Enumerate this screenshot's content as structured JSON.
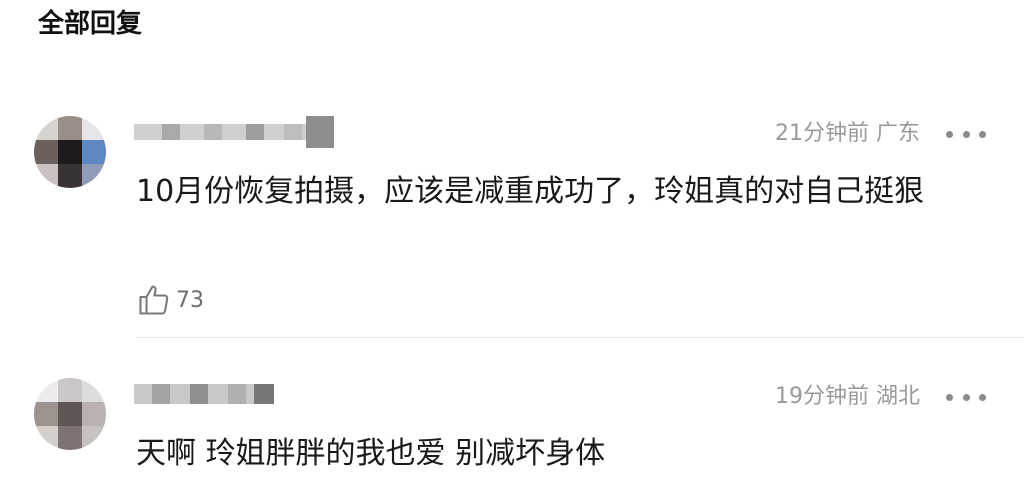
{
  "header": {
    "title": "全部回复"
  },
  "comments": [
    {
      "meta": "21分钟前 广东",
      "text": "10月份恢复拍摄，应该是减重成功了，玲姐真的对自己挺狠",
      "likes": "73",
      "like_icon": "thumbs-up-icon",
      "more_icon": "more-icon"
    },
    {
      "meta": "19分钟前 湖北",
      "text": "天啊 玲姐胖胖的我也爱 别减坏身体",
      "more_icon": "more-icon"
    }
  ],
  "colors": {
    "meta": "#9a9a9a",
    "text": "#1a1a1a",
    "like": "#6d6d6d"
  }
}
